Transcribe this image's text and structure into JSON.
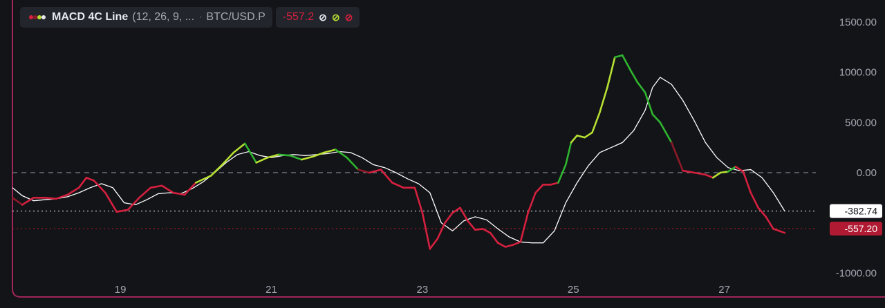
{
  "legend": {
    "indicator_title": "MACD 4C Line",
    "params": "(12, 26, 9, ...",
    "symbol": "BTC/USD.P",
    "value": "-557.2",
    "icons": [
      "eye-off-icon",
      "eye-off-icon",
      "remove-icon"
    ]
  },
  "colors": {
    "background": "#131417",
    "macd_lime": "#b7e032",
    "macd_green": "#2fb52f",
    "macd_red": "#d6203f",
    "macd_dark_red": "#8e1a28",
    "signal": "#ffffff",
    "frame": "#a0265a"
  },
  "chart_data": {
    "type": "line",
    "title": "MACD 4C Line",
    "x_unit": "day of month",
    "x_ticks": [
      19,
      21,
      23,
      25,
      27
    ],
    "x_tick_labels": [
      "19",
      "21",
      "23",
      "25",
      "27"
    ],
    "y_ticks": [
      1500,
      1000,
      500,
      0,
      -1000
    ],
    "y_tick_labels": [
      "1500.00",
      "1000.00",
      "500.00",
      "0.00",
      "-1000.00"
    ],
    "ylim": [
      -1120,
      1620
    ],
    "xlim": [
      17.57,
      28.35
    ],
    "hlines": [
      {
        "value": 0,
        "style": "dashed"
      },
      {
        "value": -382.74,
        "style": "dotted",
        "label": "-382.74"
      },
      {
        "value": -557.2,
        "style": "dotted-red",
        "label": "-557.20"
      }
    ],
    "series": [
      {
        "kind": "macd",
        "x": [
          17.57,
          17.7,
          17.85,
          18.0,
          18.15,
          18.3,
          18.45,
          18.55,
          18.65,
          18.8,
          18.95,
          19.1,
          19.25,
          19.4,
          19.55,
          19.7,
          19.85,
          20.0,
          20.2,
          20.35,
          20.5,
          20.65,
          20.8,
          20.95,
          21.1,
          21.25,
          21.4,
          21.55,
          21.7,
          21.85,
          22.0,
          22.15,
          22.3,
          22.45,
          22.6,
          22.75,
          22.9,
          23.0,
          23.1,
          23.2,
          23.3,
          23.4,
          23.5,
          23.6,
          23.7,
          23.8,
          23.9,
          24.0,
          24.1,
          24.2,
          24.3,
          24.4,
          24.5,
          24.6,
          24.7,
          24.8,
          24.9,
          24.97,
          25.05,
          25.15,
          25.25,
          25.35,
          25.45,
          25.55,
          25.65,
          25.75,
          25.85,
          25.95,
          26.05,
          26.15,
          26.3,
          26.45,
          26.6,
          26.75,
          26.85,
          26.95,
          27.05,
          27.15,
          27.25,
          27.35,
          27.45,
          27.55,
          27.65,
          27.8
        ],
        "y": [
          -250,
          -320,
          -250,
          -250,
          -260,
          -220,
          -150,
          -50,
          -80,
          -200,
          -390,
          -370,
          -250,
          -150,
          -130,
          -200,
          -220,
          -100,
          -30,
          80,
          200,
          290,
          100,
          150,
          180,
          170,
          130,
          160,
          200,
          230,
          150,
          30,
          0,
          30,
          -100,
          -150,
          -150,
          -400,
          -760,
          -660,
          -500,
          -400,
          -350,
          -480,
          -570,
          -560,
          -600,
          -700,
          -740,
          -720,
          -690,
          -400,
          -200,
          -120,
          -120,
          -100,
          80,
          300,
          370,
          350,
          400,
          600,
          850,
          1150,
          1170,
          1030,
          900,
          800,
          580,
          500,
          300,
          20,
          0,
          -20,
          -50,
          0,
          10,
          60,
          10,
          -200,
          -350,
          -440,
          -560,
          -600
        ],
        "colors": [
          "dr",
          "dr",
          "r",
          "r",
          "r",
          "r",
          "r",
          "r",
          "r",
          "r",
          "r",
          "r",
          "r",
          "r",
          "r",
          "r",
          "r",
          "r",
          "l",
          "l",
          "l",
          "l",
          "g",
          "l",
          "l",
          "g",
          "g",
          "l",
          "l",
          "l",
          "g",
          "g",
          "dr",
          "r",
          "r",
          "r",
          "r",
          "r",
          "r",
          "r",
          "r",
          "r",
          "r",
          "r",
          "r",
          "r",
          "r",
          "r",
          "r",
          "r",
          "r",
          "r",
          "r",
          "r",
          "r",
          "r",
          "g",
          "g",
          "l",
          "l",
          "l",
          "l",
          "l",
          "l",
          "g",
          "g",
          "g",
          "g",
          "g",
          "g",
          "g",
          "dr",
          "r",
          "r",
          "r",
          "l",
          "l",
          "g",
          "r",
          "r",
          "r",
          "r",
          "r",
          "r"
        ]
      },
      {
        "kind": "signal",
        "x": [
          17.57,
          17.7,
          17.85,
          18.0,
          18.15,
          18.3,
          18.45,
          18.6,
          18.75,
          18.9,
          19.05,
          19.2,
          19.35,
          19.5,
          19.65,
          19.8,
          19.95,
          20.1,
          20.25,
          20.4,
          20.55,
          20.7,
          20.85,
          21.0,
          21.15,
          21.3,
          21.45,
          21.6,
          21.75,
          21.9,
          22.05,
          22.2,
          22.35,
          22.5,
          22.65,
          22.8,
          22.95,
          23.1,
          23.25,
          23.4,
          23.55,
          23.7,
          23.85,
          24.0,
          24.15,
          24.3,
          24.45,
          24.6,
          24.75,
          24.9,
          25.05,
          25.2,
          25.35,
          25.5,
          25.65,
          25.8,
          25.95,
          26.05,
          26.15,
          26.3,
          26.45,
          26.6,
          26.75,
          26.9,
          27.05,
          27.2,
          27.35,
          27.5,
          27.65,
          27.8
        ],
        "y": [
          -150,
          -230,
          -280,
          -270,
          -260,
          -240,
          -200,
          -150,
          -110,
          -150,
          -300,
          -320,
          -270,
          -210,
          -200,
          -210,
          -160,
          -90,
          0,
          100,
          180,
          210,
          170,
          150,
          170,
          180,
          170,
          180,
          190,
          210,
          200,
          150,
          80,
          50,
          0,
          -60,
          -110,
          -200,
          -500,
          -580,
          -480,
          -440,
          -470,
          -560,
          -640,
          -690,
          -700,
          -700,
          -580,
          -300,
          -100,
          70,
          200,
          250,
          300,
          420,
          620,
          850,
          950,
          880,
          720,
          520,
          300,
          150,
          50,
          20,
          30,
          -50,
          -200,
          -382.74
        ]
      }
    ]
  }
}
